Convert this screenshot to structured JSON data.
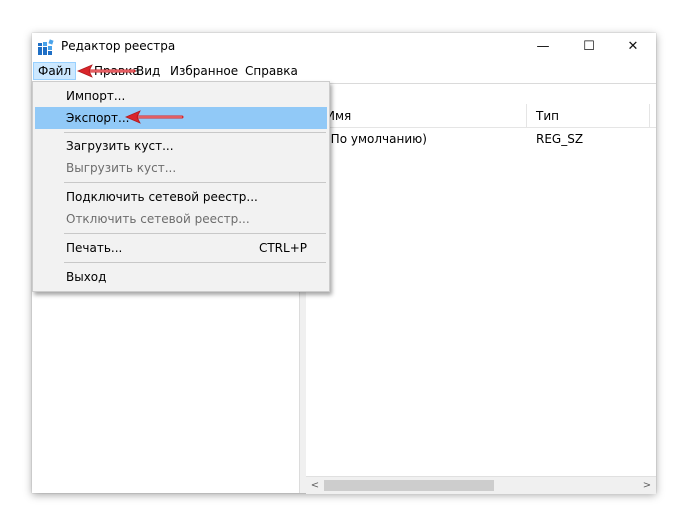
{
  "window": {
    "title": "Редактор реестра",
    "minimize_glyph": "—",
    "maximize_glyph": "☐",
    "close_glyph": "✕"
  },
  "menubar": {
    "items": [
      {
        "label": "Файл"
      },
      {
        "label": "Правка"
      },
      {
        "label": "Вид"
      },
      {
        "label": "Избранное"
      },
      {
        "label": "Справка"
      }
    ]
  },
  "list": {
    "columns": [
      "Имя",
      "Тип"
    ],
    "rows": [
      {
        "name": "(По умолчанию)",
        "type": "REG_SZ"
      }
    ]
  },
  "scrollbar": {
    "left_arrow": "<",
    "right_arrow": ">"
  },
  "file_menu": {
    "items": [
      {
        "label": "Импорт...",
        "enabled": true
      },
      {
        "label": "Экспорт...",
        "enabled": true,
        "highlighted": true
      },
      {
        "label": "Загрузить куст...",
        "enabled": true
      },
      {
        "label": "Выгрузить куст...",
        "enabled": false
      },
      {
        "label": "Подключить сетевой реестр...",
        "enabled": true
      },
      {
        "label": "Отключить сетевой реестр...",
        "enabled": false
      },
      {
        "label": "Печать...",
        "accelerator": "CTRL+P",
        "enabled": true
      },
      {
        "label": "Выход",
        "enabled": true
      }
    ]
  },
  "colors": {
    "highlight": "#91c9f7",
    "annotation_arrow": "#d9252a"
  },
  "icons": [
    "registry-editor-icon",
    "annotation-arrow"
  ]
}
